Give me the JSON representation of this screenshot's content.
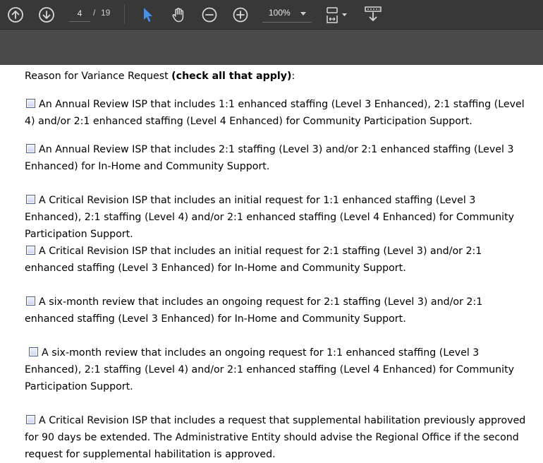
{
  "toolbar": {
    "icons": [
      "arrow-up-circle-icon",
      "arrow-down-circle-icon",
      "select-cursor-icon",
      "hand-tool-icon",
      "zoom-out-icon",
      "zoom-in-icon",
      "page-fit-icon",
      "download-icon"
    ],
    "current_page": "4",
    "page_separator": "/",
    "total_pages": "19",
    "zoom": "100%",
    "accent_color": "#4a90e2"
  },
  "document": {
    "heading_prefix": "Reason for Variance Request ",
    "heading_bold": "(check all that apply)",
    "heading_suffix": ":",
    "items": [
      {
        "text_line1": "An Annual Review ISP that includes 1:1 enhanced staffing (Level 3 Enhanced), 2:1 staffing (Level 4)",
        "text_rest": "and/or 2:1 enhanced staffing (Level 4 Enhanced) for Community Participation Support."
      },
      {
        "text_line1": "An Annual Review ISP that includes 2:1 staffing (Level 3) and/or 2:1 enhanced staffing (Level 3",
        "text_rest": "Enhanced) for In-Home and Community Support."
      },
      {
        "text_line1": "A Critical Revision ISP that includes an initial request for 1:1 enhanced staffing (Level 3 Enhanced), 2:1",
        "text_rest": "staffing (Level 4) and/or 2:1 enhanced staffing (Level 4 Enhanced) for Community Participation Support."
      },
      {
        "text_line1": "A Critical Revision ISP that includes an initial request for 2:1 staffing (Level 3) and/or 2:1 enhanced",
        "text_rest": "staffing (Level 3 Enhanced) for In-Home and Community Support."
      },
      {
        "text_line1": "A six-month review that includes an ongoing request for 2:1 staffing (Level 3) and/or 2:1 enhanced",
        "text_rest": "staffing (Level 3 Enhanced) for In-Home and Community Support."
      },
      {
        "text_line1": "A six-month review that includes an ongoing request for 1:1 enhanced staffing (Level 3 Enhanced),",
        "text_rest": "2:1 staffing (Level 4) and/or 2:1 enhanced staffing (Level 4 Enhanced) for Community Participation Support."
      },
      {
        "text_line1": "A Critical Revision ISP that includes a request that supplemental habilitation previously approved for",
        "text_rest": "90 days be extended. The Administrative Entity should advise the Regional Office if the second request for supplemental habilitation is approved."
      }
    ]
  }
}
